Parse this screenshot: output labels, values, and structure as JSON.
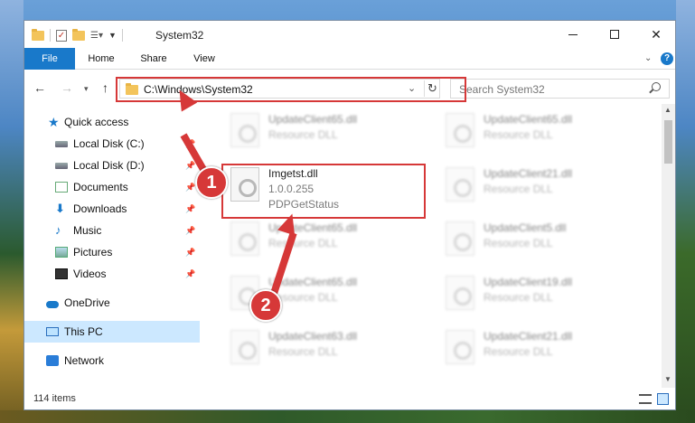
{
  "window": {
    "title": "System32",
    "ribbon_tabs": [
      "File",
      "Home",
      "Share",
      "View"
    ],
    "help": "?"
  },
  "address": {
    "path": "C:\\Windows\\System32",
    "search_placeholder": "Search System32"
  },
  "nav_pane": {
    "items": [
      {
        "label": "Quick access",
        "icon": "star-icon"
      },
      {
        "label": "Local Disk (C:)",
        "icon": "drive-icon"
      },
      {
        "label": "Local Disk (D:)",
        "icon": "drive-icon"
      },
      {
        "label": "Documents",
        "icon": "documents-icon"
      },
      {
        "label": "Downloads",
        "icon": "downloads-icon"
      },
      {
        "label": "Music",
        "icon": "music-icon"
      },
      {
        "label": "Pictures",
        "icon": "pictures-icon"
      },
      {
        "label": "Videos",
        "icon": "videos-icon"
      },
      {
        "label": "OneDrive",
        "icon": "onedrive-icon"
      },
      {
        "label": "This PC",
        "icon": "this-pc-icon"
      },
      {
        "label": "Network",
        "icon": "network-icon"
      }
    ]
  },
  "files": {
    "col1": [
      {
        "name": "UpdateClient65.dll",
        "line2": "Resource DLL",
        "line3": ""
      },
      {
        "name": "Imgetst.dll",
        "line2": "1.0.0.255",
        "line3": "PDPGetStatus"
      },
      {
        "name": "UpdateClient65.dll",
        "line2": "Resource DLL",
        "line3": ""
      },
      {
        "name": "UpdateClient65.dll",
        "line2": "Resource DLL",
        "line3": ""
      },
      {
        "name": "UpdateClient63.dll",
        "line2": "Resource DLL",
        "line3": ""
      }
    ],
    "col2": [
      {
        "name": "UpdateClient65.dll",
        "line2": "Resource DLL"
      },
      {
        "name": "UpdateClient21.dll",
        "line2": "Resource DLL"
      },
      {
        "name": "UpdateClient5.dll",
        "line2": "Resource DLL"
      },
      {
        "name": "UpdateClient19.dll",
        "line2": "Resource DLL"
      },
      {
        "name": "UpdateClient21.dll",
        "line2": "Resource DLL"
      }
    ]
  },
  "status": {
    "item_count": "114 items"
  },
  "annotations": {
    "badge1": "1",
    "badge2": "2",
    "color": "#d63838"
  }
}
